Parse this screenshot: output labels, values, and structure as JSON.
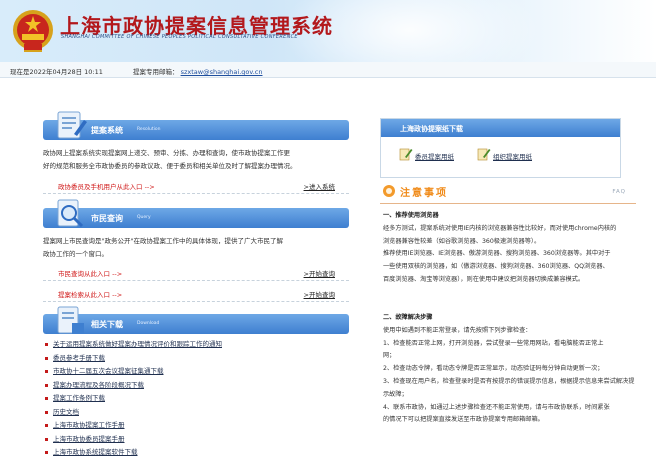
{
  "header": {
    "title": "上海市政协提案信息管理系统",
    "subtitle": "SHANGHAI COMMITTEE OF CHINESE PEOPLES POLITICAL CONSULTATIVE CONFERENCE"
  },
  "infobar": {
    "date_text": "现在是2022年04月28日 10:11",
    "email_label": "提案专用邮箱：",
    "email": "szxtaw@shanghai.gov.cn"
  },
  "proposal_system": {
    "title": "提案系统",
    "title_en": "Resolution",
    "desc_line1": "政协网上提案系统实现提案网上递交、预审、分拣、办理和查询，使市政协提案工作更",
    "desc_line2": "好的规范和服务全市政协委员的参政议政、便于委员和相关单位及时了解提案办理情况。",
    "entry_label": "政协委员及手机用户从此入口 -->",
    "entry_link": ">进入系统"
  },
  "public_query": {
    "title": "市民查询",
    "title_en": "Query",
    "desc_line1": "提案网上市民查询是\"政务公开\"在政协提案工作中的具体体现，提供了广大市民了解",
    "desc_line2": "政协工作的一个窗口。",
    "entry1_label": "市民查询从此入口 -->",
    "entry1_link": ">开始查询",
    "entry2_label": "提案检索从此入口 -->",
    "entry2_link": ">开始查询"
  },
  "downloads": {
    "title": "相关下载",
    "title_en": "Download",
    "items": [
      "关于运用提案系统做好提案办理情况评价和跟踪工作的通知",
      "委员参考手册下载",
      "市政协十二届五次会议提案征集通下载",
      "提案办理流程及各阶段概况下载",
      "提案工作条例下载",
      "历史文档",
      "上海市政协提案工作手册",
      "上海市政协委员提案手册",
      "上海市政协系统提案软件下载"
    ]
  },
  "right_download": {
    "title": "上海政协提案纸下载",
    "file1": "委员提案用纸",
    "file2": "组织提案用纸"
  },
  "notice": {
    "title": "注意事项",
    "faq": "FAQ",
    "section1_title": "一、推荐使用浏览器",
    "section1_lines": [
      "经多方测试，提案系统对使用IE内核的浏览器兼容性比较好，而对使用chrome内核的",
      "浏览器兼容性较差（如谷歌浏览器、360极速浏览器等）。",
      "推荐使用IE浏览器、IE浏览器、傲游浏览器、搜狗浏览器、360浏览器等。其中对于",
      "一些使用双核的浏览器，如（傲游浏览器、搜狗浏览器、360浏览器、QQ浏览器、",
      "百度浏览器、淘宝等浏览器），则在使用中建议把浏览器切换成兼容模式。"
    ],
    "section2_title": "二、故障解决步骤",
    "section2_lines": [
      "使用中如遇到不能正常登录，请先按照下列步骤检查：",
      "1、检查能否正常上网，打开浏览器，尝试登录一些常用网站，看电脑能否正常上",
      "网；",
      "2、检查动态令牌，看动态令牌是否正常显示，动态验证码每分钟自动更新一次；",
      "3、检查现在用户名，检查登录时是否有按提示的错误提示信息，根据提示信息来尝试解决提示故障；",
      "4、联系市政协，如通过上述步骤检查还不能正常使用，请与市政协联系，时间紧张",
      "的情况下可以把提案直接发送至市政协提案专用邮箱邮箱。"
    ]
  },
  "colors": {
    "title_red": "#b3181c",
    "bar_blue": "#3e7fd0",
    "entry_red": "#d01818",
    "notice_orange": "#f08a18"
  }
}
